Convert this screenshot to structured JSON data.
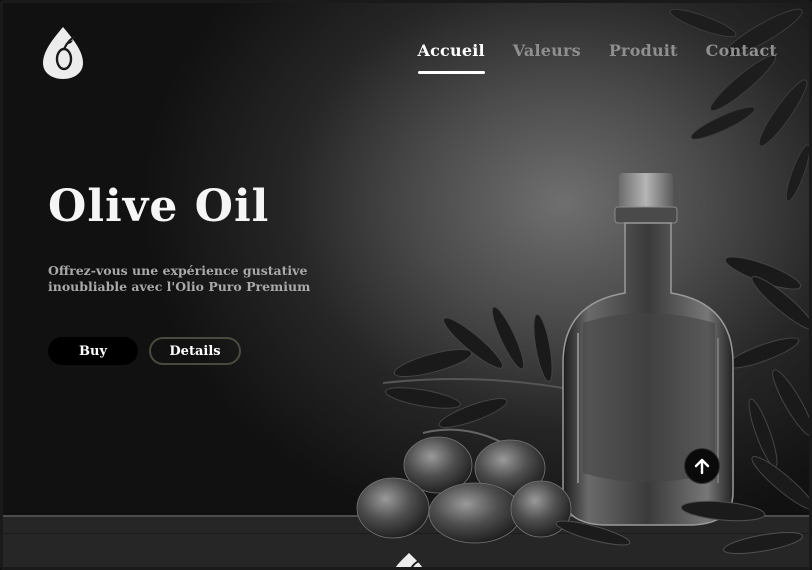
{
  "nav": {
    "items": [
      {
        "label": "Accueil",
        "active": true
      },
      {
        "label": "Valeurs",
        "active": false
      },
      {
        "label": "Produit",
        "active": false
      },
      {
        "label": "Contact",
        "active": false
      }
    ]
  },
  "hero": {
    "title": "Olive Oil",
    "subtitle": "Offrez-vous une expérience gustative inoubliable avec l'Olio Puro Premium",
    "buy_label": "Buy",
    "details_label": "Details"
  },
  "icons": {
    "logo": "olive-drop-logo-icon",
    "scroll_top": "arrow-up-icon"
  },
  "colors": {
    "accent": "#ffffff",
    "muted_nav": "#8f8f8f",
    "details_border": "#4a4a3e"
  }
}
